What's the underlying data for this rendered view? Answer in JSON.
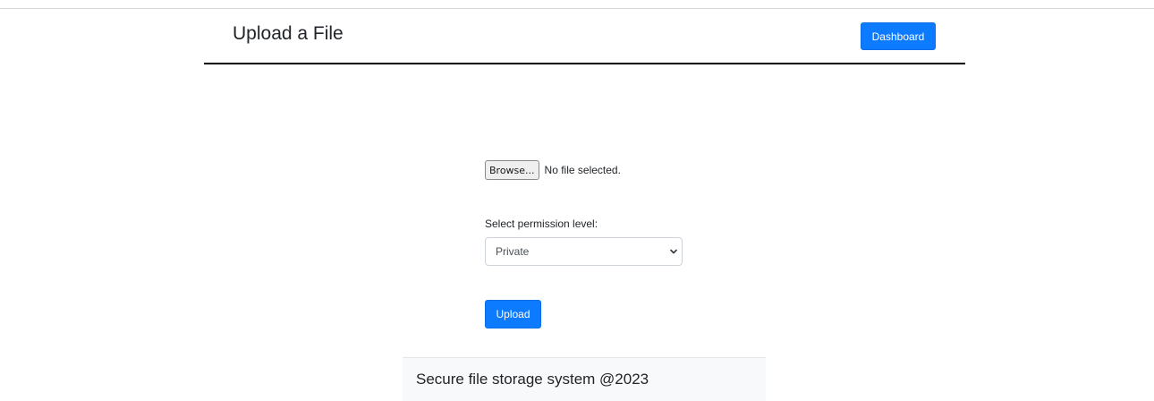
{
  "header": {
    "title": "Upload a File",
    "dashboard_label": "Dashboard"
  },
  "form": {
    "browse_label": "Browse...",
    "file_status": "No file selected.",
    "permission_label": "Select permission level:",
    "permission_selected": "Private",
    "upload_label": "Upload"
  },
  "footer": {
    "text": "Secure file storage system @2023"
  },
  "icons": {
    "dropdown": "chevron-down-icon"
  },
  "colors": {
    "primary_button": "#0d7bff",
    "footer_background": "#f8f9fa",
    "header_rule": "#000000"
  }
}
